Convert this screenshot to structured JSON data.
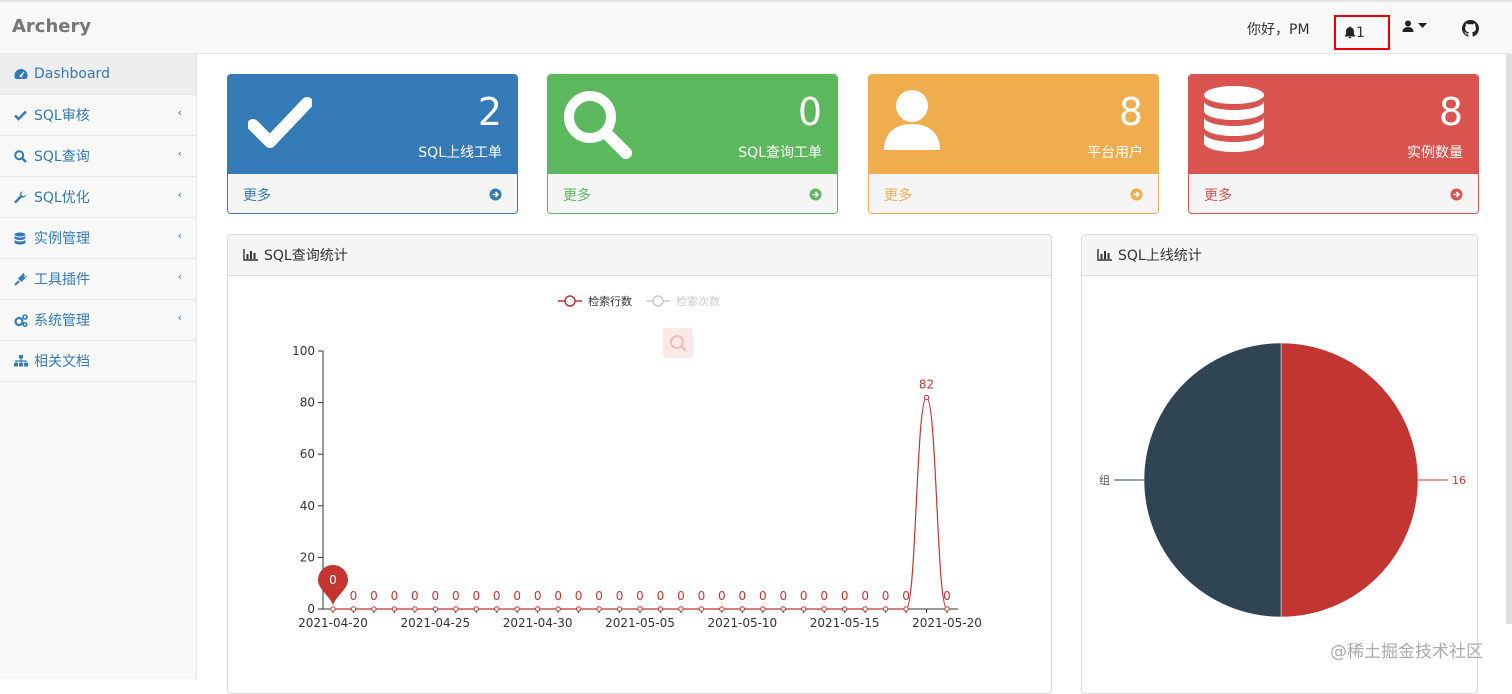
{
  "navbar": {
    "brand": "Archery",
    "greeting": "你好，PM",
    "notification_count": "1"
  },
  "sidebar": {
    "items": [
      {
        "label": "Dashboard",
        "icon": "dashboard-icon",
        "has_children": false,
        "active": true
      },
      {
        "label": "SQL审核",
        "icon": "check-icon",
        "has_children": true
      },
      {
        "label": "SQL查询",
        "icon": "search-icon",
        "has_children": true
      },
      {
        "label": "SQL优化",
        "icon": "wrench-icon",
        "has_children": true
      },
      {
        "label": "实例管理",
        "icon": "database-icon",
        "has_children": true
      },
      {
        "label": "工具插件",
        "icon": "plug-icon",
        "has_children": true
      },
      {
        "label": "系统管理",
        "icon": "cogs-icon",
        "has_children": true
      },
      {
        "label": "相关文档",
        "icon": "sitemap-icon",
        "has_children": false
      }
    ]
  },
  "cards": [
    {
      "value": "2",
      "label": "SQL上线工单",
      "more": "更多",
      "color": "#337ab7",
      "icon": "check-icon"
    },
    {
      "value": "0",
      "label": "SQL查询工单",
      "more": "更多",
      "color": "#5cb85c",
      "icon": "search-icon"
    },
    {
      "value": "8",
      "label": "平台用户",
      "more": "更多",
      "color": "#f0ad4e",
      "icon": "user-icon"
    },
    {
      "value": "8",
      "label": "实例数量",
      "more": "更多",
      "color": "#d9534f",
      "icon": "database-icon"
    }
  ],
  "panels": {
    "query_stats_title": "SQL查询统计",
    "release_stats_title": "SQL上线统计"
  },
  "chart_data": [
    {
      "type": "line",
      "legend": [
        {
          "name": "检索行数",
          "enabled": true,
          "color": "#c23531"
        },
        {
          "name": "检索次数",
          "enabled": false,
          "color": "#cccccc"
        }
      ],
      "x": [
        "2021-04-20",
        "2021-04-21",
        "2021-04-22",
        "2021-04-23",
        "2021-04-24",
        "2021-04-25",
        "2021-04-26",
        "2021-04-27",
        "2021-04-28",
        "2021-04-29",
        "2021-04-30",
        "2021-05-01",
        "2021-05-02",
        "2021-05-03",
        "2021-05-04",
        "2021-05-05",
        "2021-05-06",
        "2021-05-07",
        "2021-05-08",
        "2021-05-09",
        "2021-05-10",
        "2021-05-11",
        "2021-05-12",
        "2021-05-13",
        "2021-05-14",
        "2021-05-15",
        "2021-05-16",
        "2021-05-17",
        "2021-05-18",
        "2021-05-19",
        "2021-05-20"
      ],
      "x_tick_labels": [
        "2021-04-20",
        "2021-04-25",
        "2021-04-30",
        "2021-05-05",
        "2021-05-10",
        "2021-05-15",
        "2021-05-20"
      ],
      "series": [
        {
          "name": "检索行数",
          "values": [
            0,
            0,
            0,
            0,
            0,
            0,
            0,
            0,
            0,
            0,
            0,
            0,
            0,
            0,
            0,
            0,
            0,
            0,
            0,
            0,
            0,
            0,
            0,
            0,
            0,
            0,
            0,
            0,
            0,
            82,
            0
          ]
        }
      ],
      "ylim": [
        0,
        100
      ],
      "y_ticks": [
        0,
        20,
        40,
        60,
        80,
        100
      ],
      "markpoint": {
        "label": "0"
      },
      "color": "#c23531"
    },
    {
      "type": "pie",
      "slices": [
        {
          "label": "16",
          "color": "#c23531"
        },
        {
          "label": "组",
          "color": "#2f4554"
        }
      ],
      "values": [
        1,
        1
      ]
    }
  ],
  "watermark": "@稀土掘金技术社区"
}
